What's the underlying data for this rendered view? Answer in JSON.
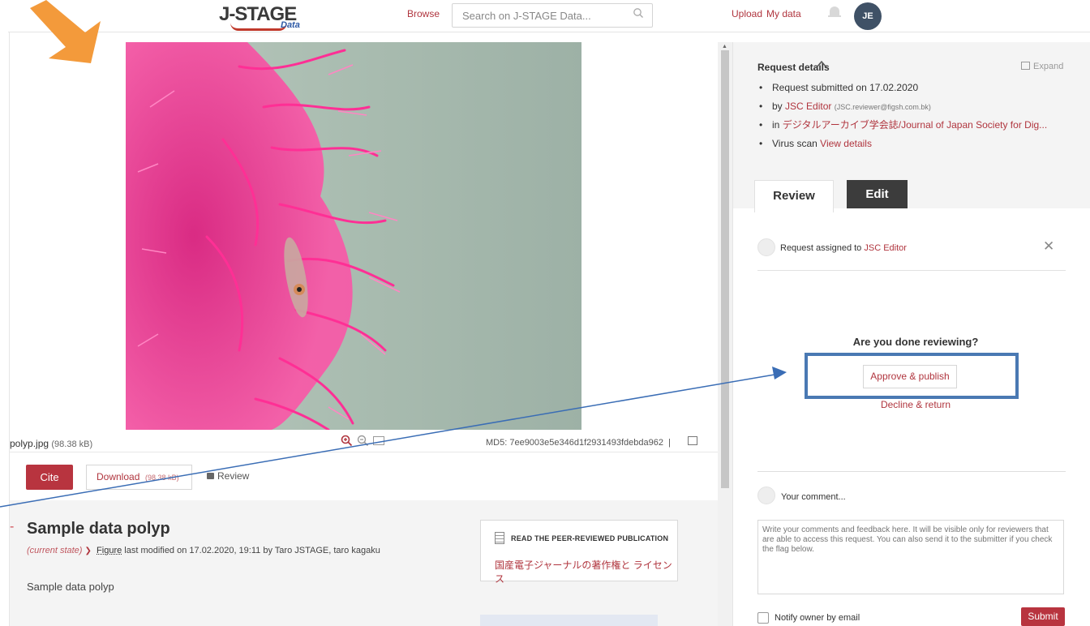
{
  "header": {
    "logo_main": "J-STAGE",
    "logo_sub": "Data",
    "browse": "Browse",
    "search_placeholder": "Search on J-STAGE Data...",
    "upload": "Upload",
    "my_data": "My data",
    "avatar_initials": "JE"
  },
  "file": {
    "name": "polyp.jpg",
    "size": "(98.38 kB)",
    "md5": "MD5: 7ee9003e5e346d1f2931493fdebda962",
    "md5_sep": "|"
  },
  "actions": {
    "cite": "Cite",
    "download": "Download",
    "download_size": "(98.38 kB)",
    "review": "Review"
  },
  "item": {
    "collapse_mark": "-",
    "title": "Sample data polyp",
    "state": "(current state)",
    "type": "Figure",
    "modified": "last modified on 17.02.2020, 19:11 by Taro JSTAGE, taro kagaku",
    "description": "Sample data polyp",
    "publication_header": "READ THE PEER-REVIEWED PUBLICATION",
    "publication_title": "国産電子ジャーナルの著作権と ライセンス"
  },
  "request": {
    "title": "Request details",
    "expand": "Expand",
    "submitted": "Request submitted on 17.02.2020",
    "by_prefix": "by",
    "by_name": "JSC Editor",
    "by_email": "(JSC.reviewer@figsh.com.bk)",
    "in_prefix": "in",
    "in_journal": "デジタルアーカイブ学会誌/Journal of Japan Society for Dig...",
    "virus_prefix": "Virus scan",
    "virus_link": "View details"
  },
  "tabs": {
    "review": "Review",
    "edit": "Edit"
  },
  "review_panel": {
    "assigned_prefix": "Request assigned to",
    "assigned_name": "JSC Editor",
    "close": "✕",
    "question": "Are you done reviewing?",
    "approve": "Approve & publish",
    "decline": "Decline & return",
    "comment_label": "Your comment...",
    "comment_placeholder": "Write your comments and feedback here. It will be visible only for reviewers that are able to access this request. You can also send it to the submitter if you check the flag below.",
    "notify": "Notify owner by email",
    "submit": "Submit"
  },
  "colors": {
    "accent_red": "#b8343f",
    "annotation_orange": "#f39a3b",
    "annotation_blue": "#4a79b3"
  },
  "icons": {
    "search": "magnifier-icon",
    "bell": "bell-icon",
    "zoom_in": "zoom-in-icon",
    "zoom_out": "zoom-out-icon",
    "lock": "lock-icon",
    "doc": "document-icon",
    "chevron_up": "chevron-up-icon",
    "chevron_down": "chevron-down-icon"
  }
}
